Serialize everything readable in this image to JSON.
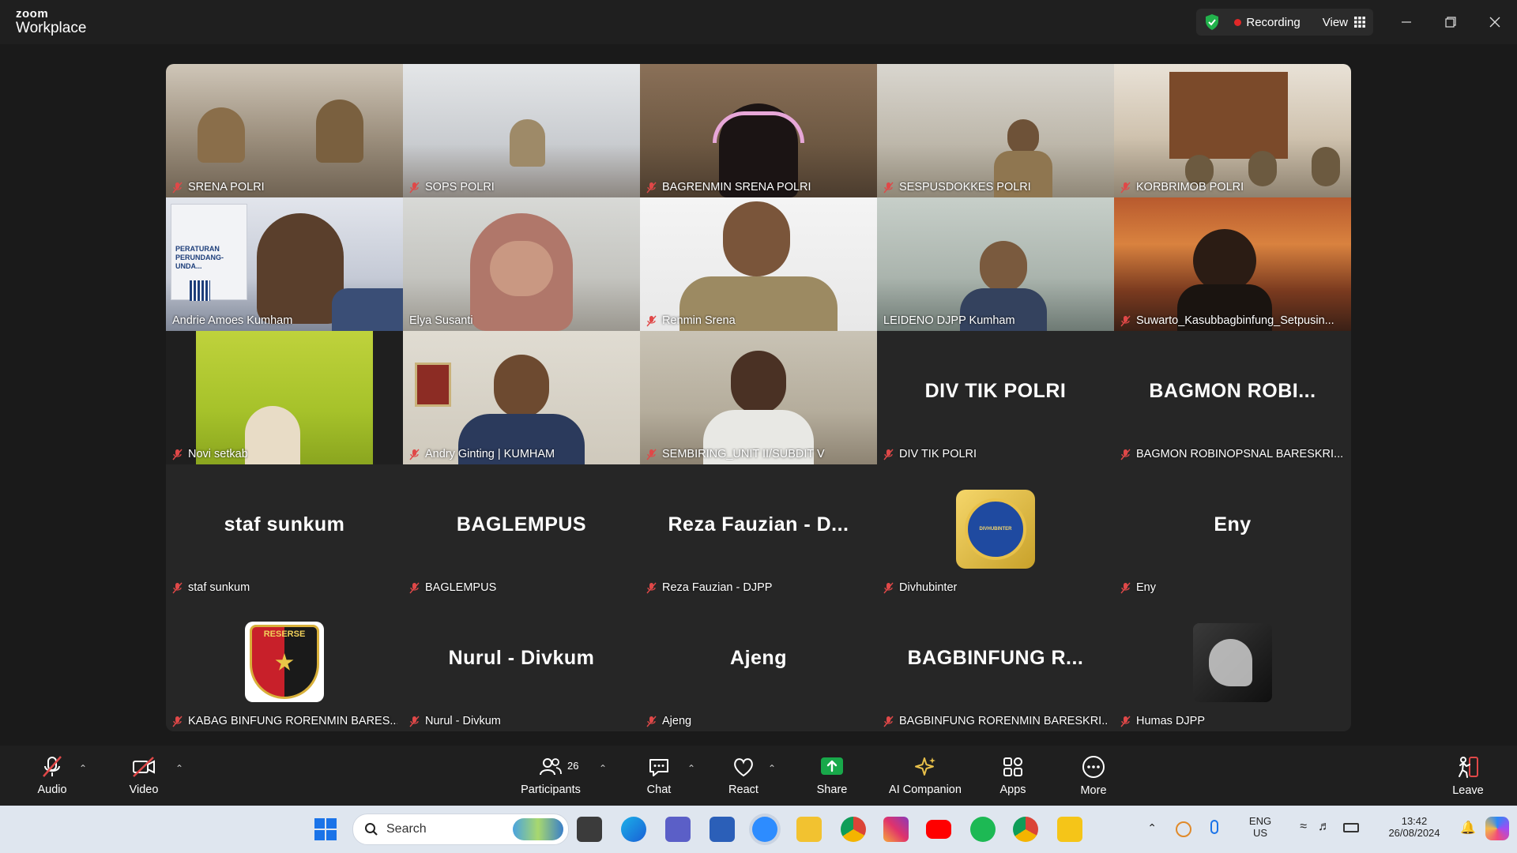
{
  "app": {
    "brand_small": "zoom",
    "brand_big": "Workplace"
  },
  "header": {
    "recording_label": "Recording",
    "view_label": "View"
  },
  "colors": {
    "active_border": "#2ed27a",
    "recording_dot": "#e02828",
    "share_green": "#18a84a",
    "mic_muted": "#e04848"
  },
  "tiles": [
    {
      "name": "SRENA POLRI",
      "display": ""
    },
    {
      "name": "SOPS POLRI",
      "display": ""
    },
    {
      "name": "BAGRENMIN SRENA POLRI",
      "display": ""
    },
    {
      "name": "SESPUSDOKKES POLRI",
      "display": ""
    },
    {
      "name": "KORBRIMOB POLRI",
      "display": ""
    },
    {
      "name": "Andrie Amoes Kumham",
      "display": "",
      "screen_text": "PERATURAN PERUNDANG-UNDA..."
    },
    {
      "name": "Elya Susanti",
      "display": ""
    },
    {
      "name": "Renmin Srena",
      "display": ""
    },
    {
      "name": "LEIDENO DJPP Kumham",
      "display": ""
    },
    {
      "name": "Suwarto_Kasubbagbinfung_Setpusin...",
      "display": ""
    },
    {
      "name": "Novi setkab",
      "display": ""
    },
    {
      "name": "Andry Ginting | KUMHAM",
      "display": ""
    },
    {
      "name": "SEMBIRING_UNIT II/SUBDIT V",
      "display": ""
    },
    {
      "name": "DIV TIK POLRI",
      "display": "DIV TIK POLRI"
    },
    {
      "name": "BAGMON ROBINOPSNAL BARESKRI...",
      "display": "BAGMON  ROBI..."
    },
    {
      "name": "staf sunkum",
      "display": "staf sunkum"
    },
    {
      "name": "BAGLEMPUS",
      "display": "BAGLEMPUS"
    },
    {
      "name": "Reza Fauzian - DJPP",
      "display": "Reza Fauzian - D..."
    },
    {
      "name": "Divhubinter",
      "display": "",
      "logo_text": "DIVHUBINTER"
    },
    {
      "name": "Eny",
      "display": "Eny"
    },
    {
      "name": "KABAG BINFUNG RORENMIN BARES...",
      "display": "",
      "logo_text": "RESERSE"
    },
    {
      "name": "Nurul - Divkum",
      "display": "Nurul - Divkum"
    },
    {
      "name": "Ajeng",
      "display": "Ajeng"
    },
    {
      "name": "BAGBINFUNG RORENMIN BARESKRI...",
      "display": "BAGBINFUNG  R..."
    },
    {
      "name": "Humas DJPP",
      "display": ""
    }
  ],
  "toolbar": {
    "audio": "Audio",
    "video": "Video",
    "participants": "Participants",
    "participants_count": "26",
    "chat": "Chat",
    "react": "React",
    "share": "Share",
    "ai": "AI Companion",
    "apps": "Apps",
    "more": "More",
    "leave": "Leave"
  },
  "taskbar": {
    "search_placeholder": "Search",
    "lang_top": "ENG",
    "lang_bottom": "US",
    "time": "13:42",
    "date": "26/08/2024"
  }
}
